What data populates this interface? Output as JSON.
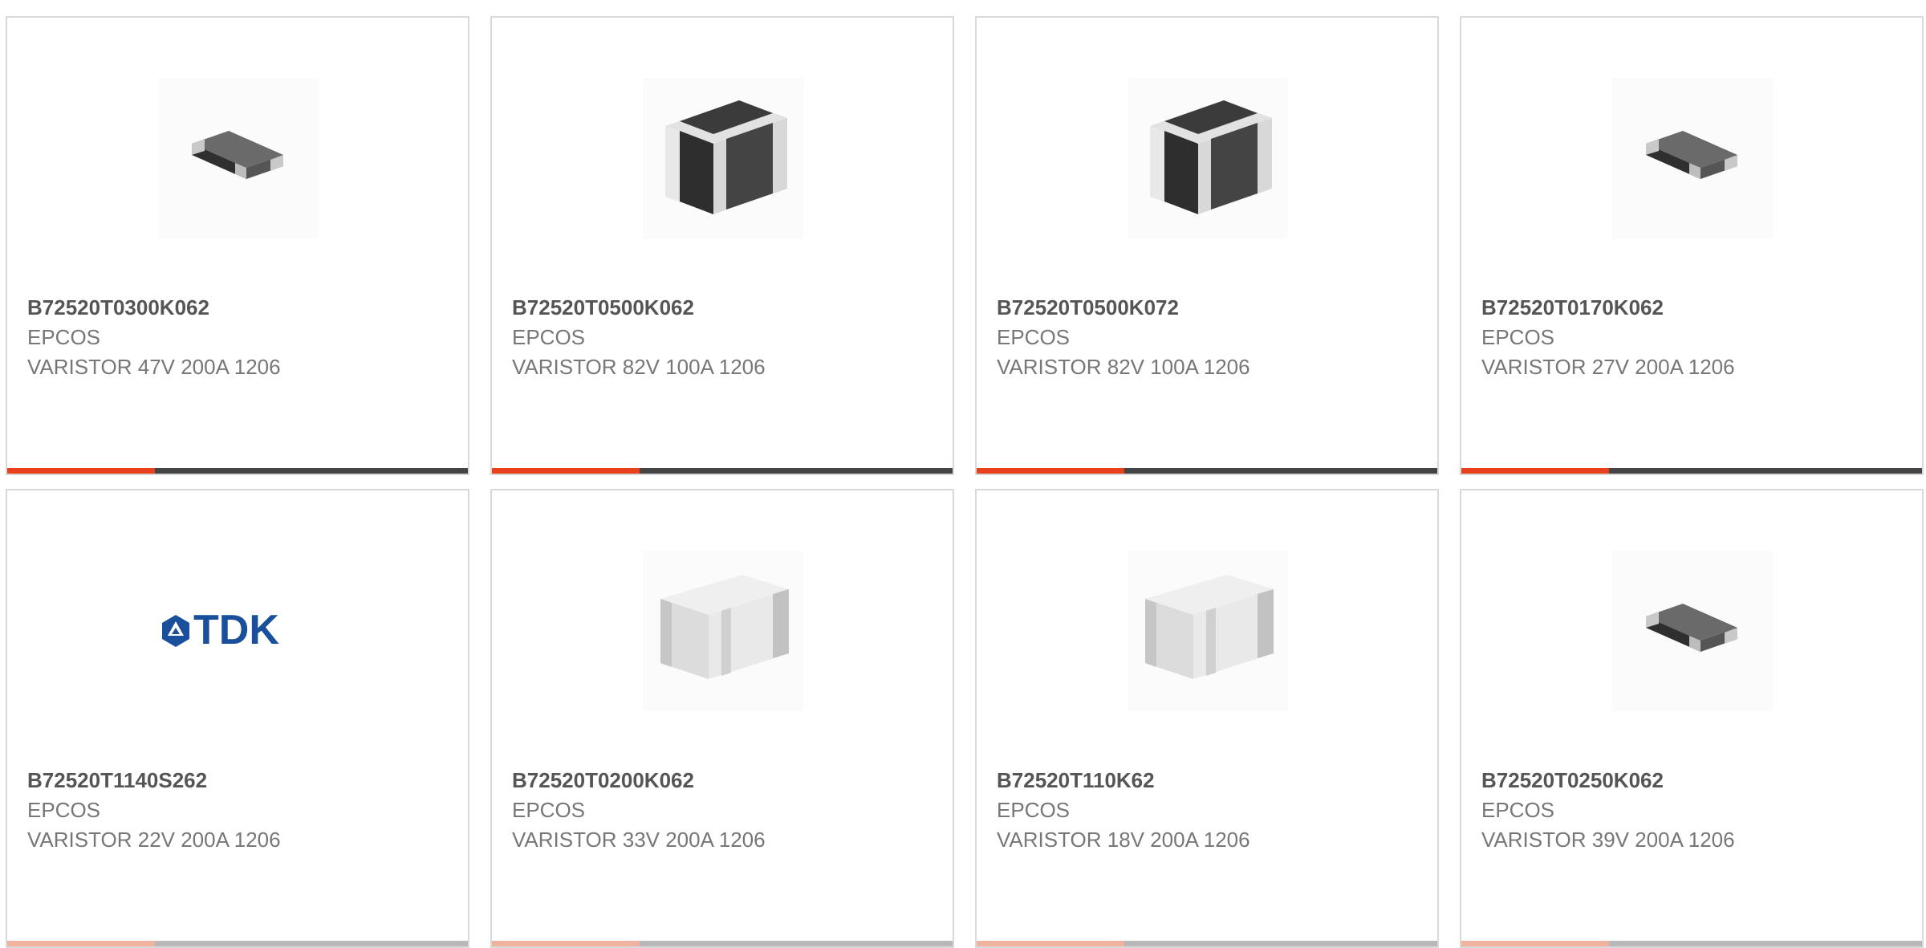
{
  "products": [
    {
      "part_number": "B72520T0300K062",
      "manufacturer": "EPCOS",
      "description": "VARISTOR 47V 200A 1206",
      "image_icon": "varistor-small-icon",
      "hover_progress": 0.32
    },
    {
      "part_number": "B72520T0500K062",
      "manufacturer": "EPCOS",
      "description": "VARISTOR 82V 100A 1206",
      "image_icon": "varistor-large-icon",
      "hover_progress": 0.32
    },
    {
      "part_number": "B72520T0500K072",
      "manufacturer": "EPCOS",
      "description": "VARISTOR 82V 100A 1206",
      "image_icon": "varistor-large-icon",
      "hover_progress": 0.32
    },
    {
      "part_number": "B72520T0170K062",
      "manufacturer": "EPCOS",
      "description": "VARISTOR 27V 200A 1206",
      "image_icon": "varistor-small-icon",
      "hover_progress": 0.32
    },
    {
      "part_number": "B72520T1140S262",
      "manufacturer": "EPCOS",
      "description": "VARISTOR 22V 200A 1206",
      "image_icon": "tdk-logo",
      "logo_text": "TDK",
      "hover_progress": 0.32
    },
    {
      "part_number": "B72520T0200K062",
      "manufacturer": "EPCOS",
      "description": "VARISTOR 33V 200A 1206",
      "image_icon": "varistor-white-icon",
      "hover_progress": 0.32
    },
    {
      "part_number": "B72520T110K62",
      "manufacturer": "EPCOS",
      "description": "VARISTOR 18V 200A 1206",
      "image_icon": "varistor-white-icon",
      "hover_progress": 0.32
    },
    {
      "part_number": "B72520T0250K062",
      "manufacturer": "EPCOS",
      "description": "VARISTOR 39V 200A 1206",
      "image_icon": "varistor-small-icon",
      "hover_progress": 0.32
    }
  ],
  "colors": {
    "accent": "#e8411c",
    "bar_dark": "#444444",
    "border": "#d9d9d9",
    "part_text": "#555555",
    "secondary_text": "#777777",
    "tdk_blue": "#1a4f9c"
  }
}
